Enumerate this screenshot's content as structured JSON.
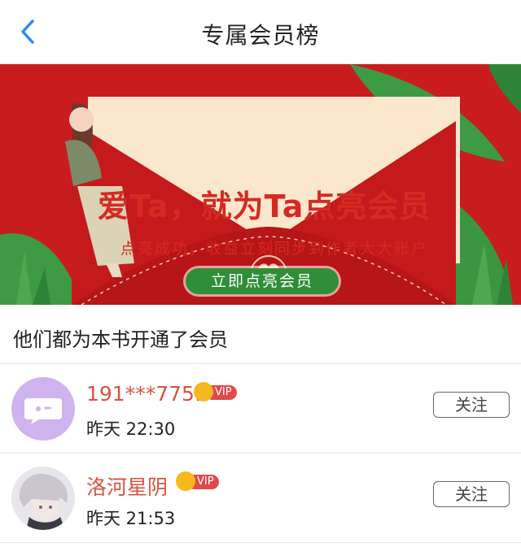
{
  "header": {
    "title": "专属会员榜",
    "back_icon": "back-chevron-icon"
  },
  "banner": {
    "headline": "爱Ta，就为Ta点亮会员",
    "subline": "点亮成功，收益立刻同步到作者大大账户",
    "cta_label": "立即点亮会员",
    "colors": {
      "background": "#c91c1f",
      "card": "#fbe7cc",
      "button": "#2f8f38"
    }
  },
  "section": {
    "title": "他们都为本书开通了会员"
  },
  "members": [
    {
      "name": "191***7751",
      "vip_label": "VIP",
      "time": "昨天 22:30",
      "follow_label": "关注",
      "avatar": "default-chat-avatar-icon"
    },
    {
      "name": "洛河星阴",
      "vip_label": "VIP",
      "time": "昨天 21:53",
      "follow_label": "关注",
      "avatar": "anime-character-avatar"
    }
  ]
}
